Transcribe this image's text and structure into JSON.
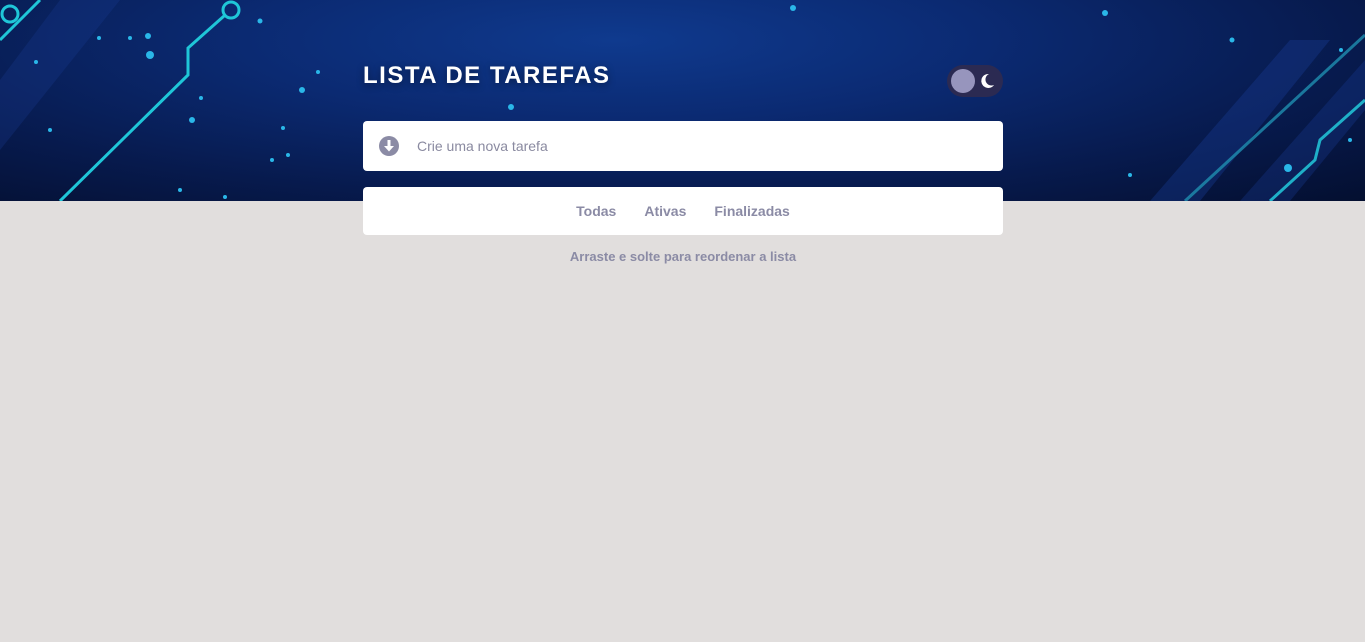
{
  "header": {
    "title": "LISTA DE TAREFAS",
    "theme_toggle_icon": "moon-icon"
  },
  "new_task": {
    "icon": "download-arrow-icon",
    "placeholder": "Crie uma nova tarefa",
    "value": ""
  },
  "filters": {
    "tabs": [
      {
        "label": "Todas"
      },
      {
        "label": "Ativas"
      },
      {
        "label": "Finalizadas"
      }
    ]
  },
  "hint": "Arraste e solte para reordenar a lista",
  "colors": {
    "page_background": "#e1dedd",
    "hero_blue": "#0b2a72",
    "circuit_cyan": "#1fc6d8",
    "muted_text": "#8b8ba5",
    "toggle_track": "#2b2a52",
    "toggle_knob": "#9795bd"
  }
}
